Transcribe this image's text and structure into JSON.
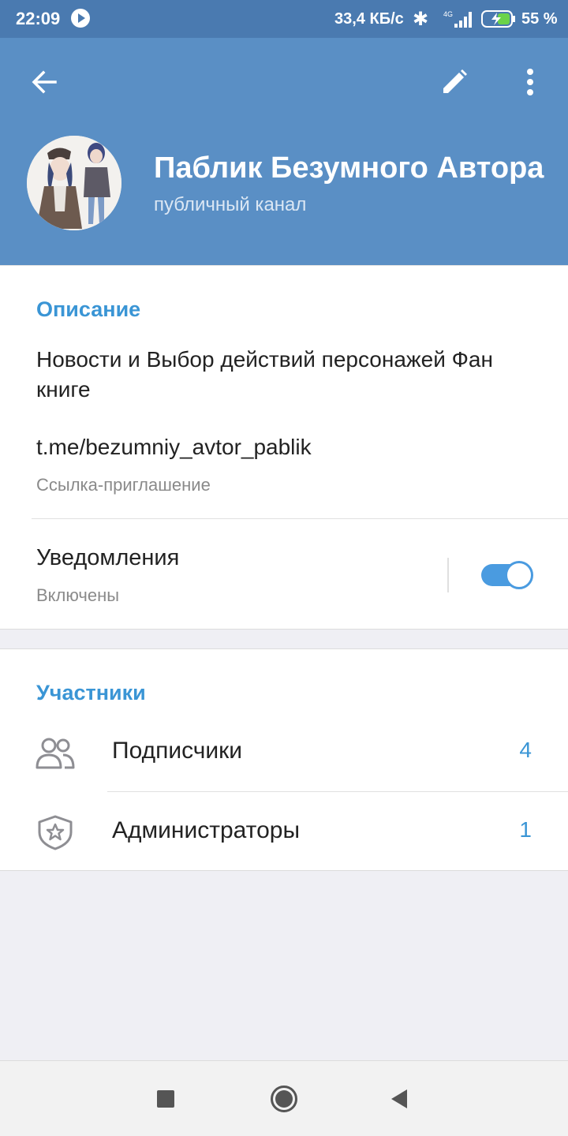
{
  "status_bar": {
    "time": "22:09",
    "speed": "33,4 КБ/с",
    "network": "4G",
    "battery": "55 %"
  },
  "header": {
    "title": "Паблик Безумного Автора",
    "subtitle": "публичный канал",
    "icons": [
      "back-arrow-icon",
      "pencil-icon",
      "more-vert-icon"
    ],
    "color": "#5a8fc5"
  },
  "info": {
    "section_title": "Описание",
    "description": "Новости и Выбор действий персонажей Фан книге",
    "link": "t.me/bezumniy_avtor_pablik",
    "link_caption": "Ссылка-приглашение",
    "notifications_label": "Уведомления",
    "notifications_state": "Включены",
    "notifications_on": true
  },
  "members": {
    "section_title": "Участники",
    "rows": [
      {
        "label": "Подписчики",
        "count": "4",
        "icon": "people-icon"
      },
      {
        "label": "Администраторы",
        "count": "1",
        "icon": "shield-star-icon"
      }
    ]
  },
  "accent_color": "#3a95d5"
}
